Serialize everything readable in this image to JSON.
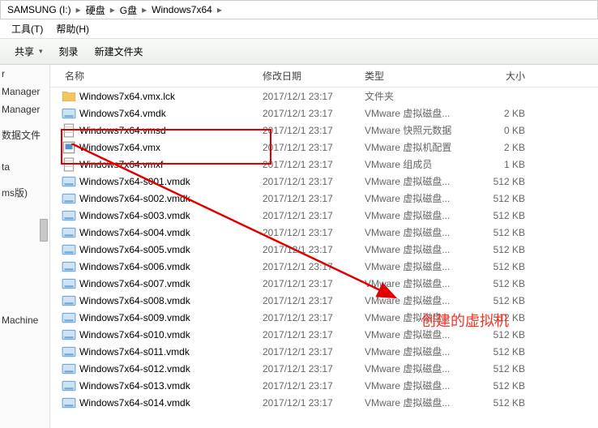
{
  "breadcrumb": {
    "items": [
      "SAMSUNG (I:)",
      "硬盘",
      "G盘",
      "Windows7x64"
    ]
  },
  "menubar": {
    "tools": "工具(T)",
    "help": "帮助(H)"
  },
  "toolbar": {
    "share": "共享",
    "burn": "刻录",
    "newfolder": "新建文件夹"
  },
  "sidebar": {
    "items": [
      "r",
      "Manager",
      "Manager",
      "",
      "数据文件",
      "",
      "",
      "ta",
      "",
      "ms版)",
      "",
      "",
      "",
      "Machine"
    ]
  },
  "columns": {
    "name": "名称",
    "date": "修改日期",
    "type": "类型",
    "size": "大小"
  },
  "files": [
    {
      "icon": "folder",
      "name": "Windows7x64.vmx.lck",
      "date": "2017/12/1 23:17",
      "type": "文件夹",
      "size": ""
    },
    {
      "icon": "disk",
      "name": "Windows7x64.vmdk",
      "date": "2017/12/1 23:17",
      "type": "VMware 虚拟磁盘...",
      "size": "2 KB"
    },
    {
      "icon": "file",
      "name": "Windows7x64.vmsd",
      "date": "2017/12/1 23:17",
      "type": "VMware 快照元数据",
      "size": "0 KB"
    },
    {
      "icon": "vmx",
      "name": "Windows7x64.vmx",
      "date": "2017/12/1 23:17",
      "type": "VMware 虚拟机配置",
      "size": "2 KB"
    },
    {
      "icon": "file",
      "name": "Windows7x64.vmxf",
      "date": "2017/12/1 23:17",
      "type": "VMware 组成员",
      "size": "1 KB"
    },
    {
      "icon": "disk",
      "name": "Windows7x64-s001.vmdk",
      "date": "2017/12/1 23:17",
      "type": "VMware 虚拟磁盘...",
      "size": "512 KB"
    },
    {
      "icon": "disk",
      "name": "Windows7x64-s002.vmdk",
      "date": "2017/12/1 23:17",
      "type": "VMware 虚拟磁盘...",
      "size": "512 KB"
    },
    {
      "icon": "disk",
      "name": "Windows7x64-s003.vmdk",
      "date": "2017/12/1 23:17",
      "type": "VMware 虚拟磁盘...",
      "size": "512 KB"
    },
    {
      "icon": "disk",
      "name": "Windows7x64-s004.vmdk",
      "date": "2017/12/1 23:17",
      "type": "VMware 虚拟磁盘...",
      "size": "512 KB"
    },
    {
      "icon": "disk",
      "name": "Windows7x64-s005.vmdk",
      "date": "2017/12/1 23:17",
      "type": "VMware 虚拟磁盘...",
      "size": "512 KB"
    },
    {
      "icon": "disk",
      "name": "Windows7x64-s006.vmdk",
      "date": "2017/12/1 23:17",
      "type": "VMware 虚拟磁盘...",
      "size": "512 KB"
    },
    {
      "icon": "disk",
      "name": "Windows7x64-s007.vmdk",
      "date": "2017/12/1 23:17",
      "type": "VMware 虚拟磁盘...",
      "size": "512 KB"
    },
    {
      "icon": "disk",
      "name": "Windows7x64-s008.vmdk",
      "date": "2017/12/1 23:17",
      "type": "VMware 虚拟磁盘...",
      "size": "512 KB"
    },
    {
      "icon": "disk",
      "name": "Windows7x64-s009.vmdk",
      "date": "2017/12/1 23:17",
      "type": "VMware 虚拟磁盘...",
      "size": "512 KB"
    },
    {
      "icon": "disk",
      "name": "Windows7x64-s010.vmdk",
      "date": "2017/12/1 23:17",
      "type": "VMware 虚拟磁盘...",
      "size": "512 KB"
    },
    {
      "icon": "disk",
      "name": "Windows7x64-s011.vmdk",
      "date": "2017/12/1 23:17",
      "type": "VMware 虚拟磁盘...",
      "size": "512 KB"
    },
    {
      "icon": "disk",
      "name": "Windows7x64-s012.vmdk",
      "date": "2017/12/1 23:17",
      "type": "VMware 虚拟磁盘...",
      "size": "512 KB"
    },
    {
      "icon": "disk",
      "name": "Windows7x64-s013.vmdk",
      "date": "2017/12/1 23:17",
      "type": "VMware 虚拟磁盘...",
      "size": "512 KB"
    },
    {
      "icon": "disk",
      "name": "Windows7x64-s014.vmdk",
      "date": "2017/12/1 23:17",
      "type": "VMware 虚拟磁盘...",
      "size": "512 KB"
    }
  ],
  "annotation": {
    "text": "创建的虚拟机"
  }
}
